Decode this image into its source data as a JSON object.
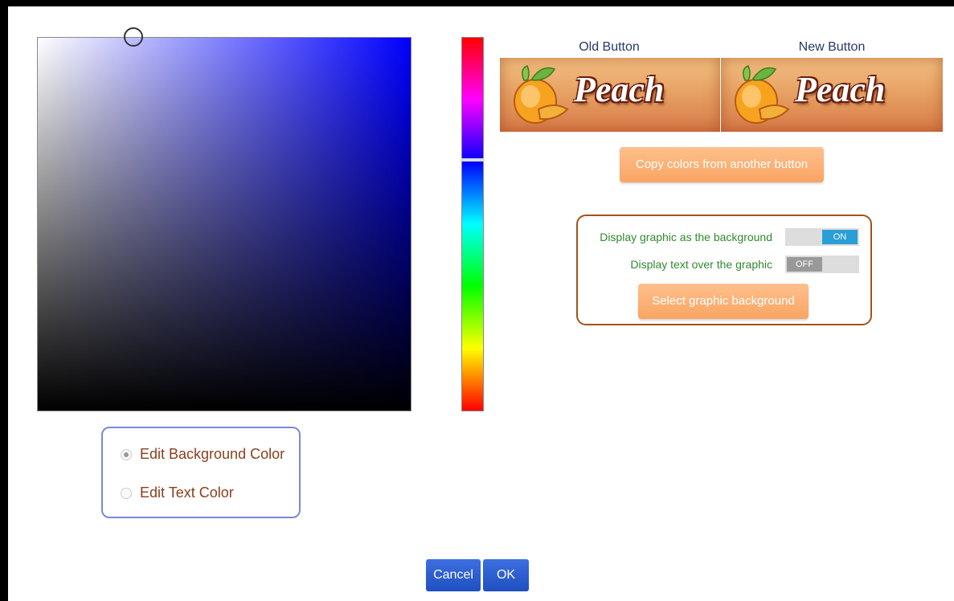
{
  "previews": {
    "old_label": "Old Button",
    "new_label": "New Button",
    "button_text": "Peach"
  },
  "copy_colors_label": "Copy colors from another button",
  "options": {
    "display_graphic_label": "Display graphic as the background",
    "display_graphic_state": "ON",
    "display_text_label": "Display text over the graphic",
    "display_text_state": "OFF",
    "select_graphic_label": "Select graphic background"
  },
  "edit_mode": {
    "background_label": "Edit Background Color",
    "text_label": "Edit Text Color",
    "selected": "background"
  },
  "dialog": {
    "cancel_label": "Cancel",
    "ok_label": "OK"
  },
  "colors": {
    "hue_color": "#0000ff",
    "toggle_on": "#2a9ed6",
    "toggle_off": "#999999",
    "accent_orange": "#f9a463",
    "dialog_button_blue": "#2556cc"
  }
}
